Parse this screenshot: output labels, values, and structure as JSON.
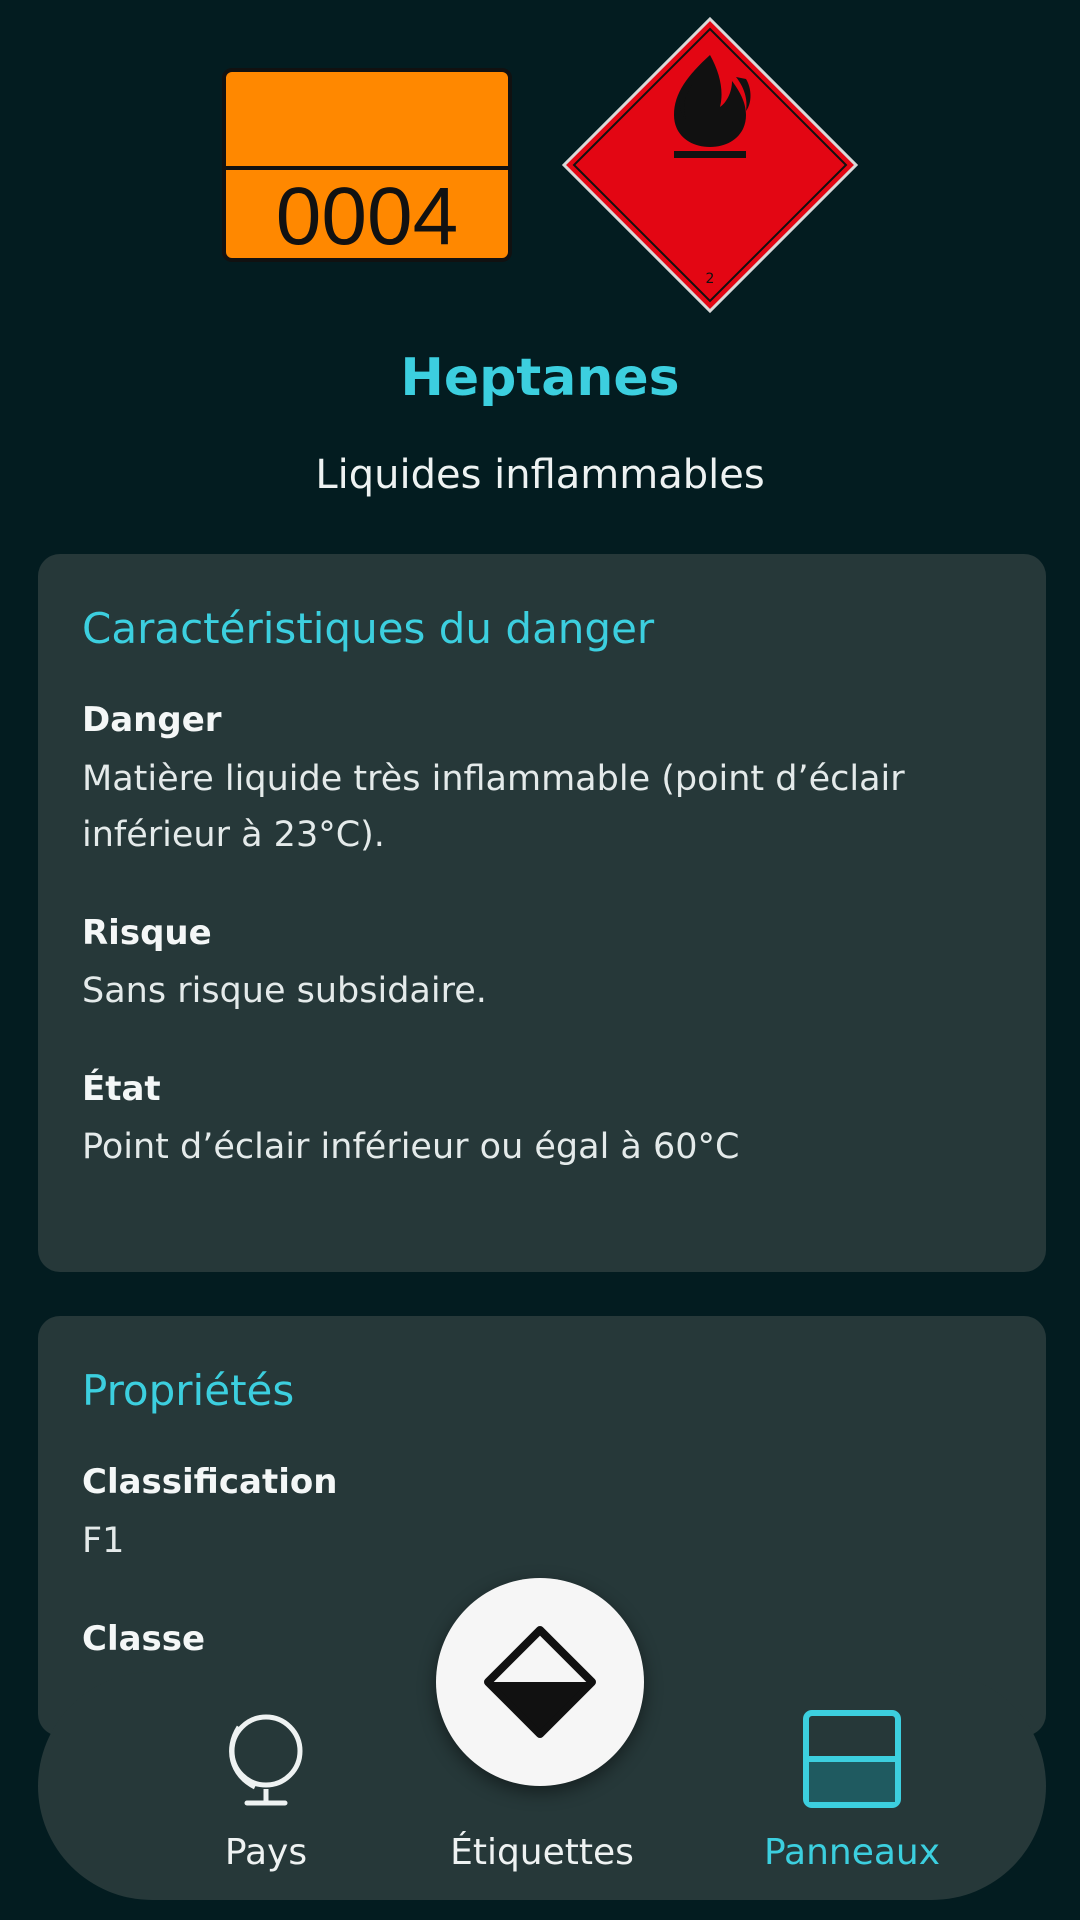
{
  "hazard_panel": {
    "un_number": "0004",
    "label_class_number": "2"
  },
  "substance": {
    "name": "Heptanes",
    "category": "Liquides inflammables"
  },
  "danger_card": {
    "title": "Caractéristiques du danger",
    "fields": [
      {
        "label": "Danger",
        "value": "Matière liquide très inflammable (point d’éclair inférieur à 23°C)."
      },
      {
        "label": "Risque",
        "value": "Sans risque subsidaire."
      },
      {
        "label": "État",
        "value": "Point d’éclair inférieur ou égal à 60°C"
      }
    ]
  },
  "properties_card": {
    "title": "Propriétés",
    "fields": [
      {
        "label": "Classification",
        "value": "F1"
      },
      {
        "label": "Classe",
        "value": ""
      }
    ]
  },
  "bottom_nav": {
    "items": [
      {
        "label": "Pays",
        "icon": "globe-icon",
        "active": false
      },
      {
        "label": "Étiquettes",
        "icon": "label-diamond-icon",
        "active": false
      },
      {
        "label": "Panneaux",
        "icon": "panel-icon",
        "active": true
      }
    ]
  },
  "colors": {
    "background": "#031c20",
    "card": "#263839",
    "accent": "#3ccfdf",
    "orange_plate": "#ff8800",
    "hazard_red": "#e30613"
  }
}
